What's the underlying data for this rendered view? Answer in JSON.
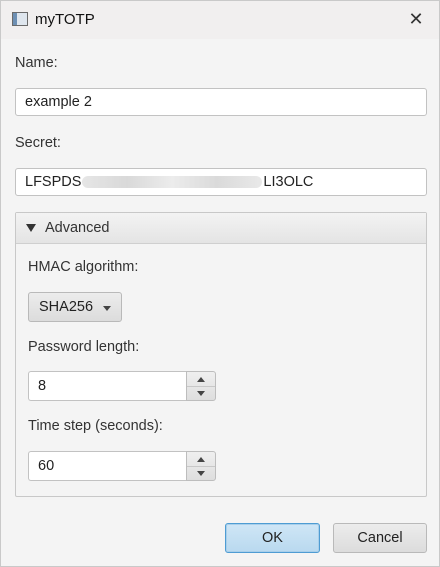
{
  "window": {
    "title": "myTOTP",
    "close_icon": "close-icon"
  },
  "form": {
    "name_label": "Name:",
    "name_value": "example 2",
    "secret_label": "Secret:",
    "secret_prefix": "LFSPDS",
    "secret_suffix": "LI3OLC"
  },
  "advanced": {
    "title": "Advanced",
    "expanded": true,
    "hmac_label": "HMAC algorithm:",
    "hmac_value": "SHA256",
    "length_label": "Password length:",
    "length_value": "8",
    "timestep_label": "Time step (seconds):",
    "timestep_value": "60"
  },
  "buttons": {
    "ok": "OK",
    "cancel": "Cancel"
  },
  "colors": {
    "accent": "#4e9cd3",
    "ok_fill": "#c4def2",
    "background": "#f4f4f4"
  }
}
